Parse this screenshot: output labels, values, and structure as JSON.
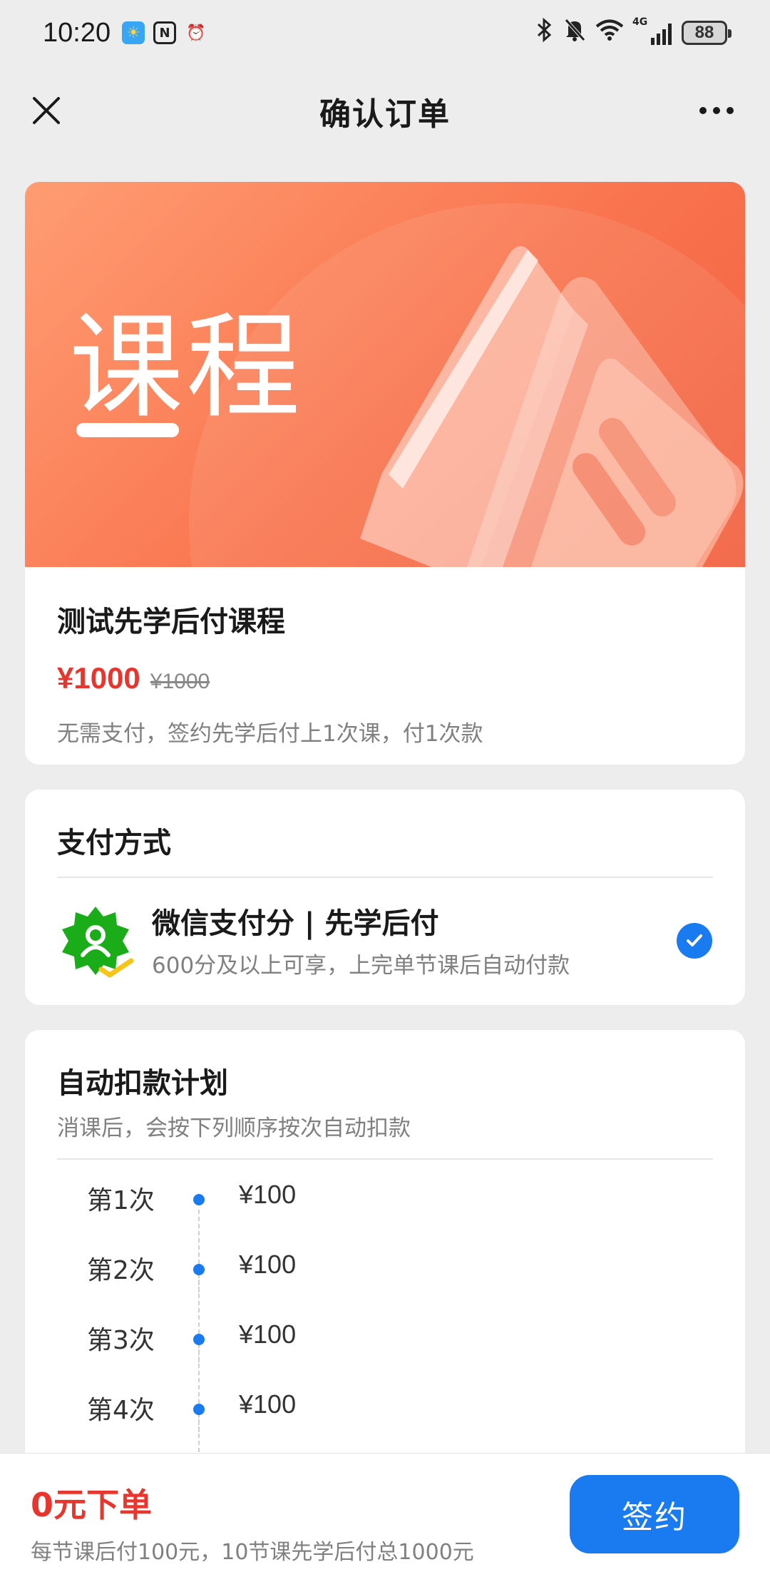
{
  "status_bar": {
    "time": "10:20",
    "icons_left": [
      "weather-icon",
      "nfc-icon",
      "alarm-icon"
    ],
    "icons_right": [
      "bluetooth-icon",
      "mute-icon",
      "wifi-icon",
      "signal-icon"
    ],
    "network": "4G",
    "battery": "88"
  },
  "nav": {
    "title": "确认订单"
  },
  "course": {
    "banner_text": "课程",
    "title": "测试先学后付课程",
    "price": "¥1000",
    "original_price": "¥1000",
    "description": "无需支付，签约先学后付上1次课，付1次款"
  },
  "payment": {
    "section_title": "支付方式",
    "method_title": "微信支付分 | 先学后付",
    "method_desc": "600分及以上可享，上完单节课后自动付款",
    "selected": true
  },
  "plan": {
    "section_title": "自动扣款计划",
    "subtitle": "消课后，会按下列顺序按次自动扣款",
    "items": [
      {
        "label": "第1次",
        "amount": "¥100"
      },
      {
        "label": "第2次",
        "amount": "¥100"
      },
      {
        "label": "第3次",
        "amount": "¥100"
      },
      {
        "label": "第4次",
        "amount": "¥100"
      }
    ]
  },
  "bottom": {
    "headline": "0元下单",
    "detail": "每节课后付100元，10节课先学后付总1000元",
    "button_label": "签约"
  },
  "colors": {
    "accent_blue": "#1a7bf0",
    "price_red": "#e8352d",
    "banner_orange": "#f9754f",
    "wechat_green": "#1aad19"
  }
}
